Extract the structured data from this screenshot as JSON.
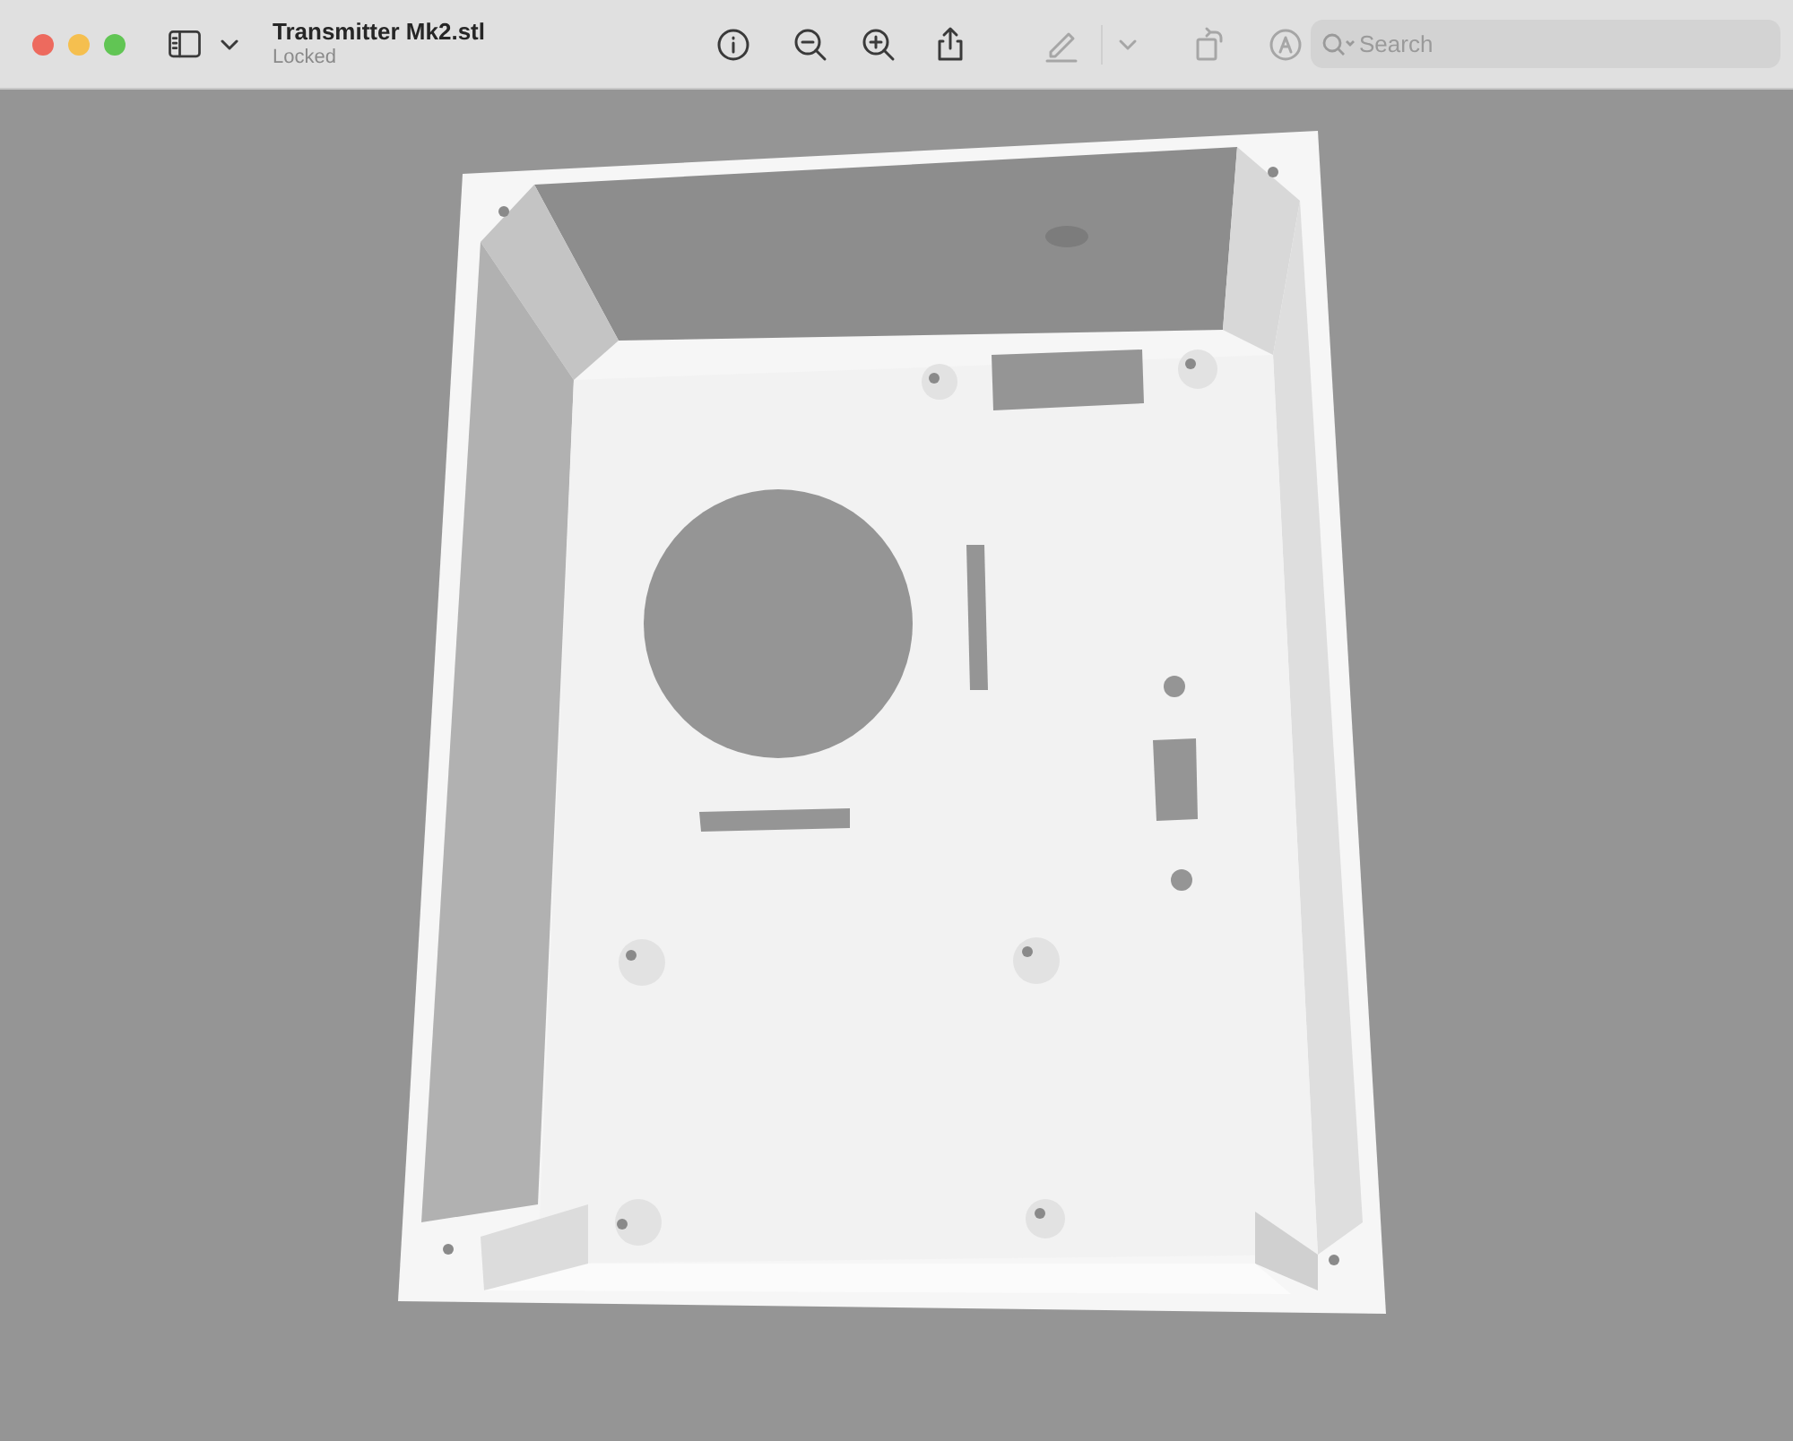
{
  "window": {
    "title": "Transmitter Mk2.stl",
    "subtitle": "Locked"
  },
  "toolbar": [
    {
      "kind": "sidebar",
      "disabled": false
    },
    {
      "kind": "chevron",
      "disabled": false
    },
    {
      "kind": "info",
      "disabled": false
    },
    {
      "kind": "zoom-out",
      "disabled": false
    },
    {
      "kind": "zoom-in",
      "disabled": false
    },
    {
      "kind": "share",
      "disabled": false
    },
    {
      "kind": "markup",
      "disabled": true
    },
    {
      "kind": "chevron",
      "disabled": true
    },
    {
      "kind": "rotate",
      "disabled": true
    },
    {
      "kind": "annotate",
      "disabled": true
    }
  ],
  "search": {
    "placeholder": "Search"
  }
}
